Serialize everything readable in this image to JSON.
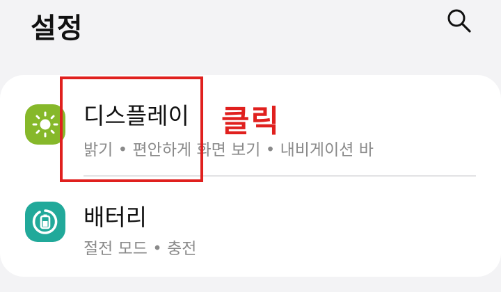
{
  "header": {
    "title": "설정",
    "search_icon": "search-icon"
  },
  "settings_items": [
    {
      "title": "디스플레이",
      "subtitle": "밝기 • 편안하게 화면 보기 • 내비게이션 바",
      "icon": "sun-icon",
      "icon_color": "#86b82a"
    },
    {
      "title": "배터리",
      "subtitle": "절전 모드 • 충전",
      "icon": "battery-icon",
      "icon_color": "#21a99a"
    }
  ],
  "annotation": {
    "label": "클릭",
    "color": "#e0201e"
  }
}
